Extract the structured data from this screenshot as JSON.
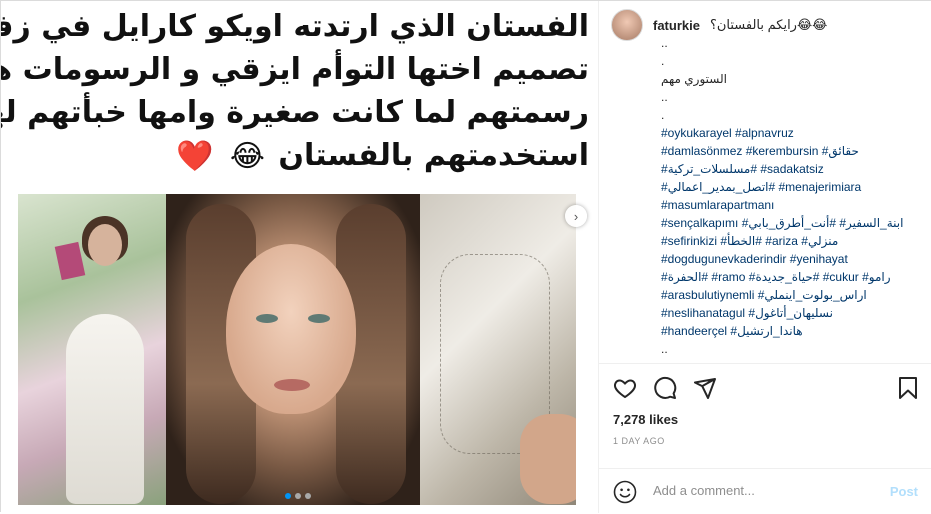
{
  "media": {
    "caption_lines": [
      "الفستان الذي ارتدته اويكو كارايل في زفافها من",
      "تصميم اختها التوأم ايزقي و الرسومات هي لأويكو",
      "رسمتهم لما كانت صغيرة وامها خبأتهم لها ؛ ويزقي",
      "استخدمتهم بالفستان"
    ],
    "caption_emojis": [
      "😂",
      "❤️"
    ],
    "next_symbol": "›",
    "carousel": {
      "count": 3,
      "active": 0
    }
  },
  "post": {
    "username": "faturkie",
    "header_text": "رايكم بالفستان؟😂😂"
  },
  "comments": [
    {
      "type": "text",
      "value": ".."
    },
    {
      "type": "text",
      "value": "."
    },
    {
      "type": "text",
      "value": "الستوري مهم"
    },
    {
      "type": "text",
      "value": ".."
    },
    {
      "type": "text",
      "value": "."
    },
    {
      "type": "tag",
      "value": "#oykukarayel #alpnavruz"
    },
    {
      "type": "tag",
      "value": "#damlasönmez #kerembursin #حقائق"
    },
    {
      "type": "tag",
      "value": "#مسلسلات_تركية# #sadakatsiz"
    },
    {
      "type": "tag",
      "value": "#اتصل_بمدير_اعمالي# #menajerimiara"
    },
    {
      "type": "tag",
      "value": "#masumlarapartmanı"
    },
    {
      "type": "tag",
      "value": "#sençalkapımı #ابنة_السفير# #أنت_أطرق_بابي"
    },
    {
      "type": "tag",
      "value": "#sefirinkizi #الخطأ# #ariza #منزلي"
    },
    {
      "type": "tag",
      "value": "#dogdugunevkaderindir #yenihayat"
    },
    {
      "type": "tag",
      "value": "#الحفرة# #ramo #حياة_جديدة# #cukur #رامو"
    },
    {
      "type": "tag",
      "value": "#arasbulutiynemli #اراس_بولوت_اينملي"
    },
    {
      "type": "tag",
      "value": "#neslihanatagul #نسليهان_أتاغول"
    },
    {
      "type": "tag",
      "value": "#handeerçel #هاندا_ارتشيل"
    },
    {
      "type": "text",
      "value": ".."
    }
  ],
  "actions": {
    "likes": "7,278 likes",
    "time_ago": "1 DAY AGO",
    "comment_placeholder": "Add a comment...",
    "post_label": "Post"
  },
  "icons": [
    "heart-icon",
    "comment-icon",
    "share-icon",
    "bookmark-icon",
    "smile-icon",
    "chevron-right-icon"
  ],
  "colors": {
    "link": "#00376b",
    "muted": "#8e8e8e",
    "post_disabled": "#b2dffc",
    "heart": "#e0182d"
  }
}
